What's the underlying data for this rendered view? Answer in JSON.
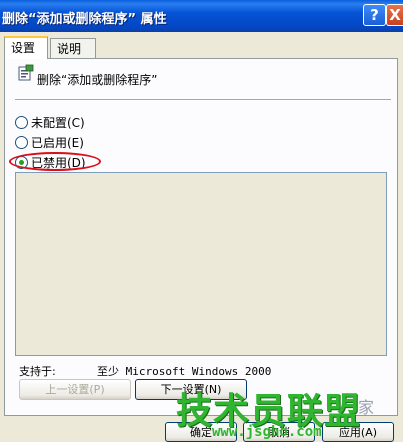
{
  "window": {
    "title": "删除“添加或删除程序” 属性",
    "help_label": "?",
    "close_label": "X"
  },
  "tabs": [
    {
      "label": "设置"
    },
    {
      "label": "说明"
    }
  ],
  "policy": {
    "title": "删除“添加或删除程序”"
  },
  "options": [
    {
      "label": "未配置(C)",
      "checked": false
    },
    {
      "label": "已启用(E)",
      "checked": false
    },
    {
      "label": "已禁用(D)",
      "checked": true
    }
  ],
  "support": {
    "label": "支持于:",
    "value": "至少 Microsoft Windows 2000"
  },
  "nav_buttons": {
    "prev": "上一设置(P)",
    "next": "下一设置(N)"
  },
  "footer_buttons": {
    "ok": "确定",
    "cancel": "取消",
    "apply": "应用(A)"
  },
  "watermark": {
    "main": "技术员联盟",
    "url": "www.jsgho.com",
    "tail": "家"
  },
  "colors": {
    "titlebar": "#0553d6",
    "highlight_ellipse": "#d8101a",
    "watermark": "#2fb52f"
  }
}
